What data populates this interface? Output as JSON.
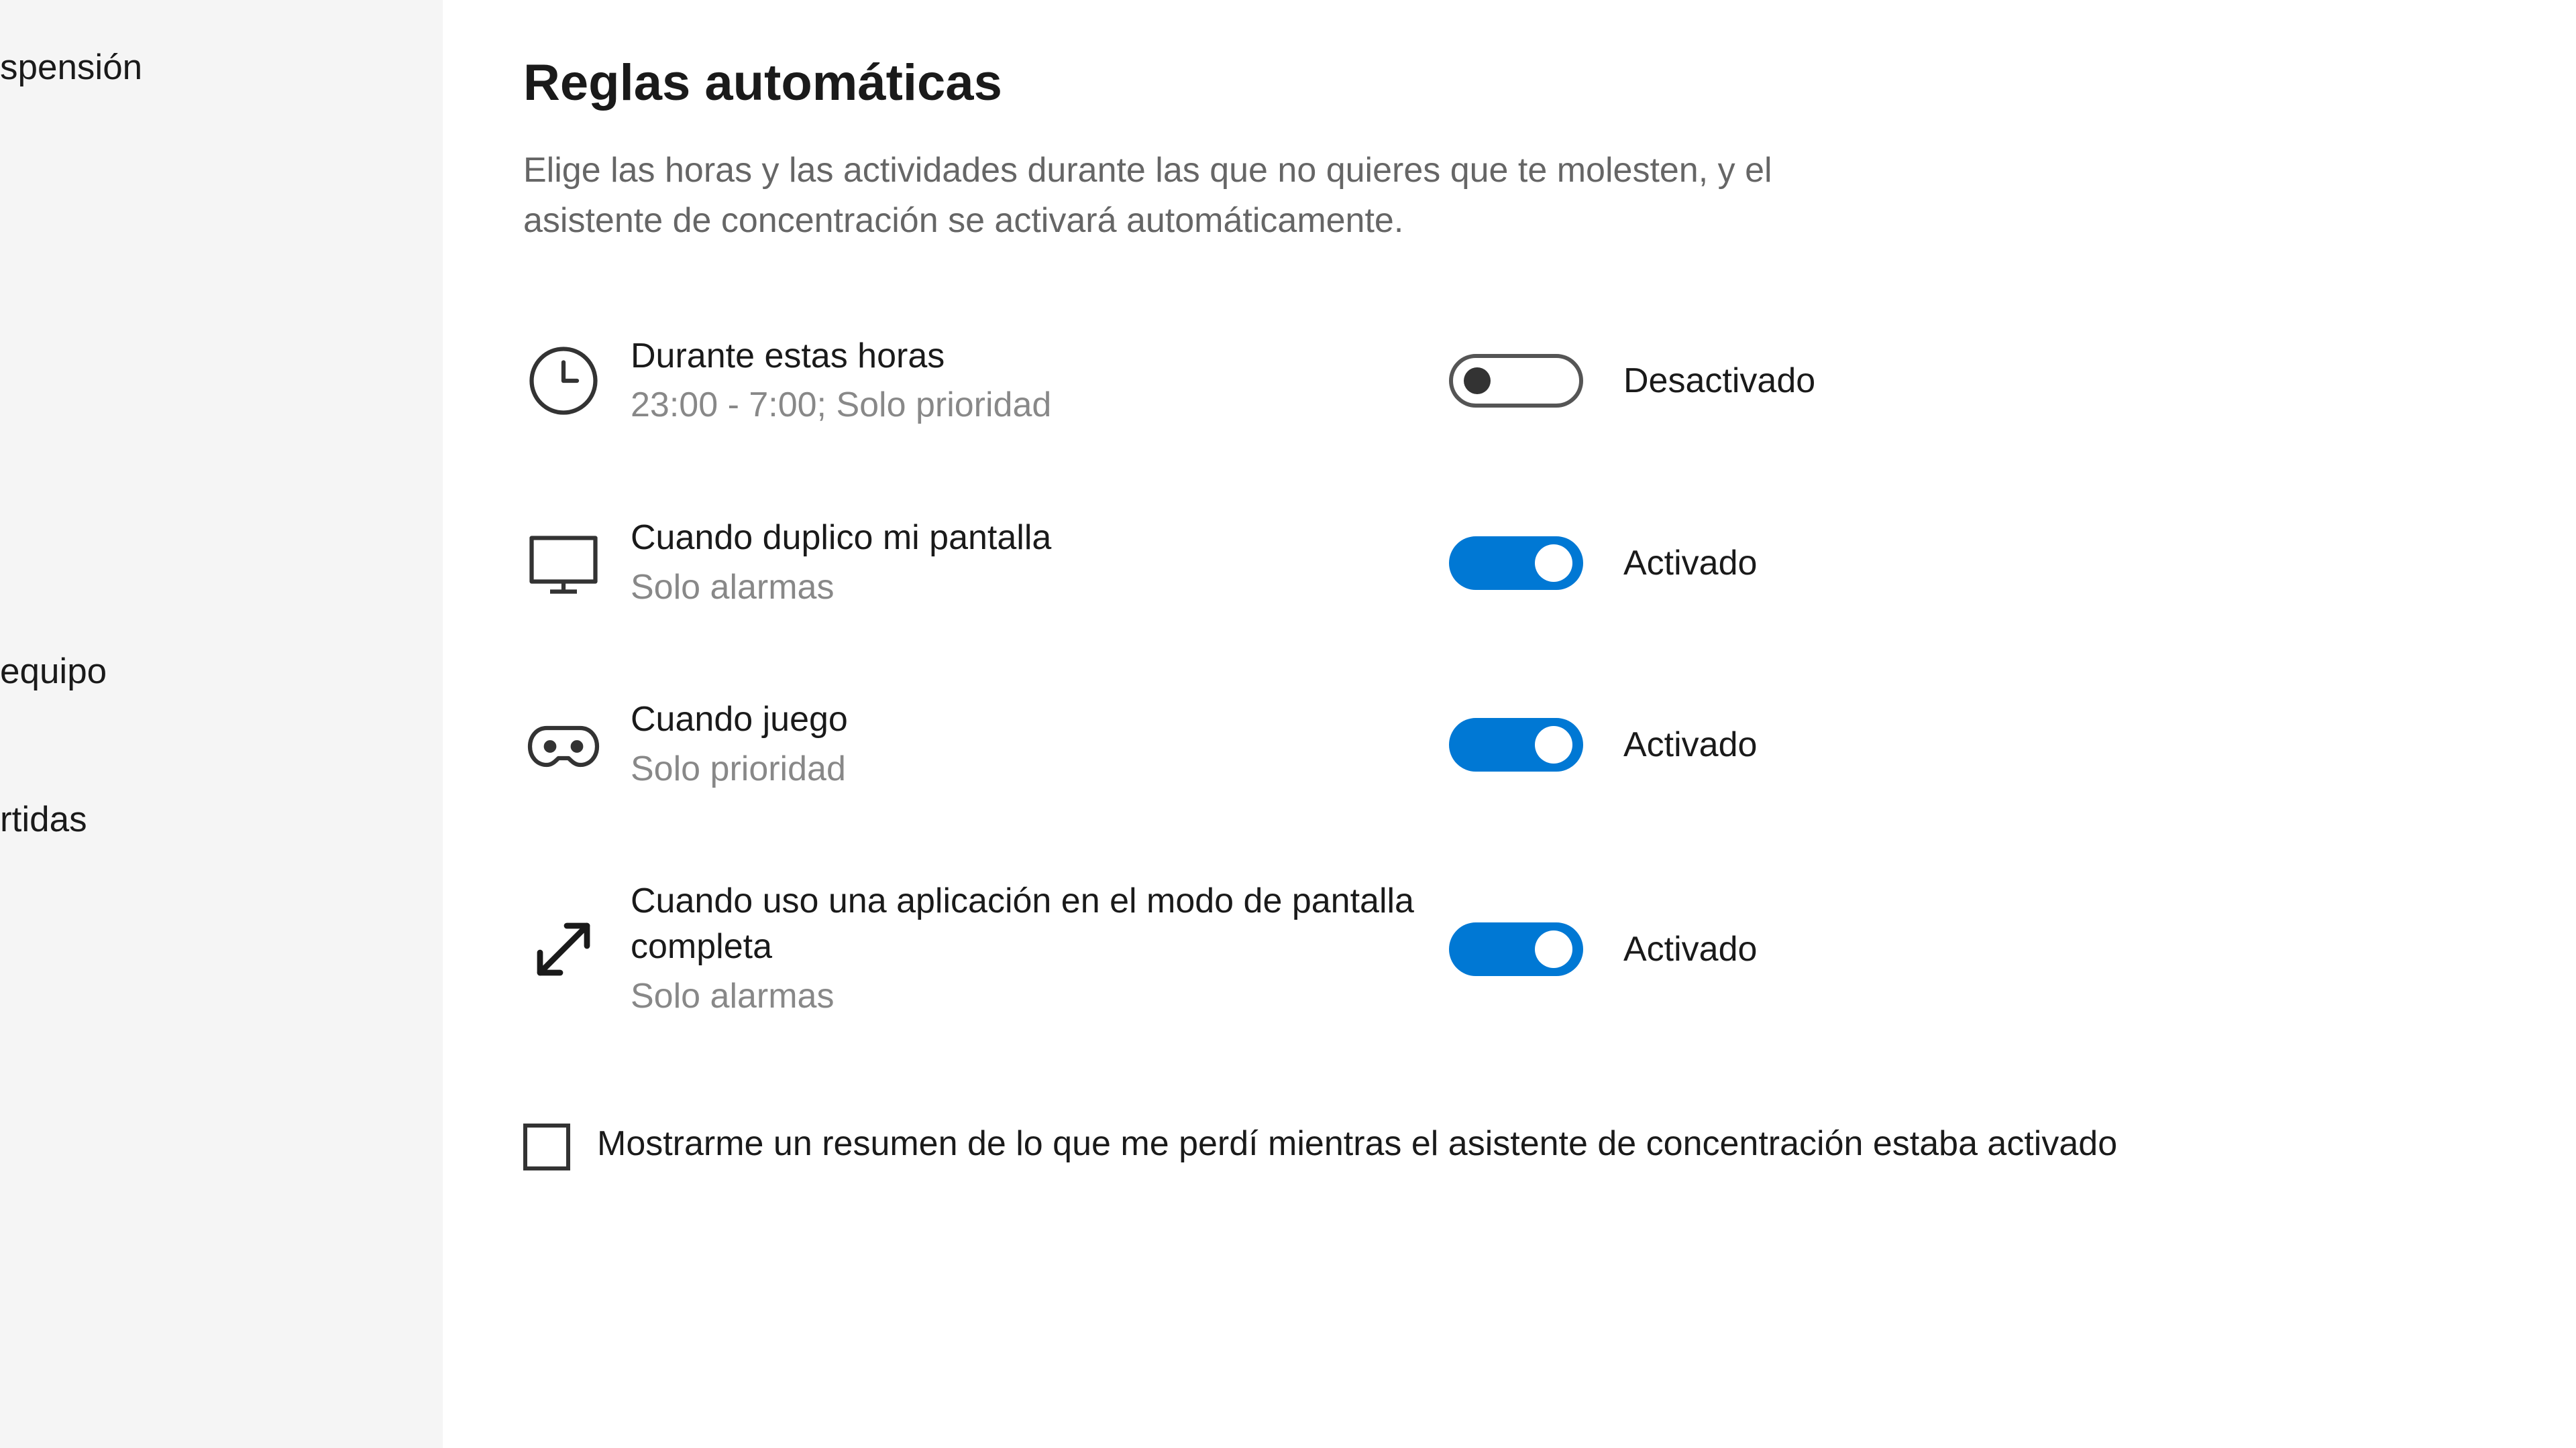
{
  "sidebar": {
    "items": [
      {
        "label": "spensión"
      },
      {
        "label": "equipo"
      },
      {
        "label": "rtidas"
      }
    ]
  },
  "main": {
    "title": "Reglas automáticas",
    "description": "Elige las horas y las actividades durante las que no quieres que te molesten, y el asistente de concentración se activará automáticamente.",
    "rules": [
      {
        "icon": "clock",
        "title": "Durante estas horas",
        "subtitle": "23:00 - 7:00; Solo prioridad",
        "on": false,
        "status": "Desactivado"
      },
      {
        "icon": "monitor",
        "title": "Cuando duplico mi pantalla",
        "subtitle": "Solo alarmas",
        "on": true,
        "status": "Activado"
      },
      {
        "icon": "gamepad",
        "title": "Cuando juego",
        "subtitle": "Solo prioridad",
        "on": true,
        "status": "Activado"
      },
      {
        "icon": "fullscreen",
        "title": "Cuando uso una aplicación en el modo de pantalla completa",
        "subtitle": "Solo alarmas",
        "on": true,
        "status": "Activado"
      }
    ],
    "checkbox": {
      "checked": false,
      "label": "Mostrarme un resumen de lo que me perdí mientras el asistente de concentración estaba activado"
    }
  }
}
